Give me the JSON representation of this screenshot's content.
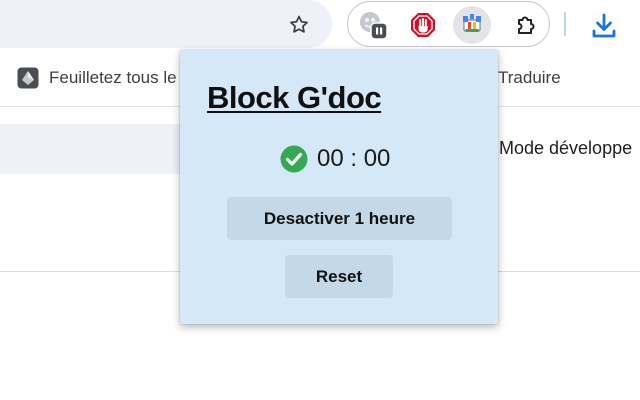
{
  "bookmarks": {
    "items": [
      {
        "label": "Feuilletez tous le"
      },
      {
        "label": "Traduire"
      }
    ]
  },
  "page": {
    "right_label": "Mode développe"
  },
  "popup": {
    "title": "Block G'doc",
    "timer": "00 : 00",
    "disable_button": "Desactiver 1 heure",
    "reset_button": "Reset"
  },
  "colors": {
    "popup_background": "#d5e8f8",
    "button_background": "#c5d8e7",
    "check_green": "#34a853",
    "stop_red": "#d50f25",
    "download_blue": "#1a73e8"
  },
  "icons": {
    "toolbar": [
      "bookmark-star-icon",
      "paused-extension-icon",
      "stop-hand-extension-icon",
      "block-gdoc-extension-icon",
      "puzzle-extensions-icon",
      "download-icon"
    ],
    "popup": [
      "check-circle-icon"
    ]
  }
}
